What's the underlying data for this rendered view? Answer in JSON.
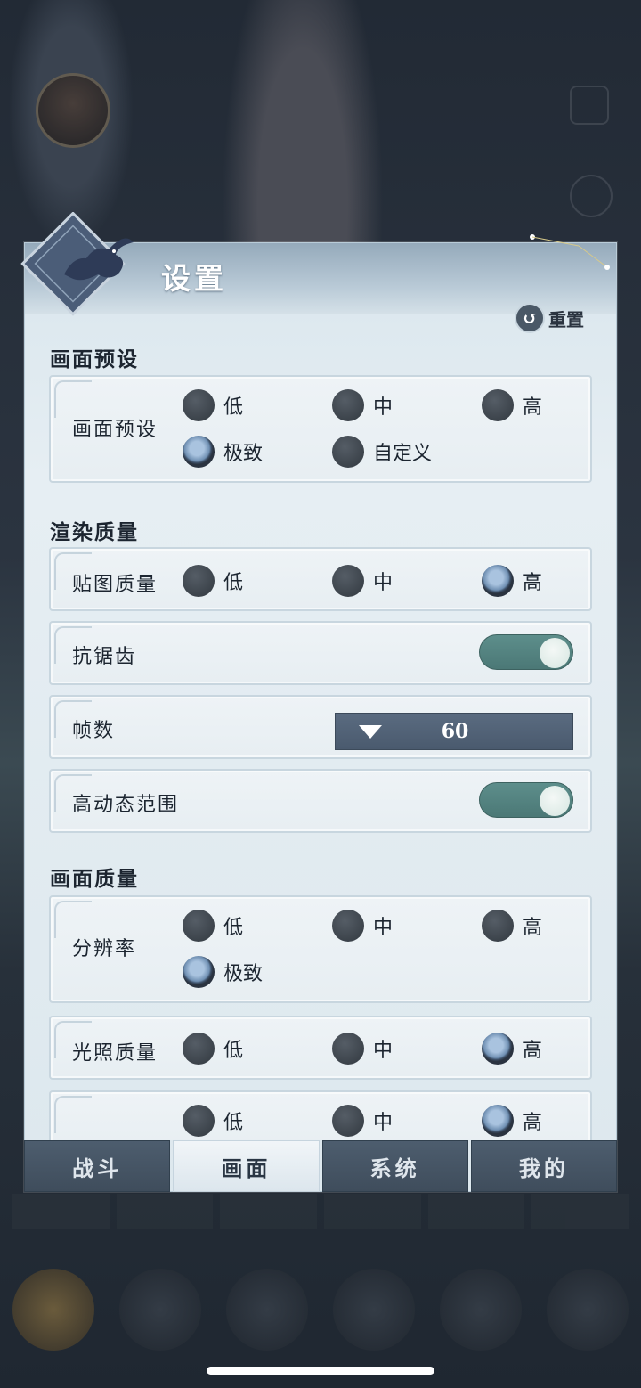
{
  "dialog": {
    "title": "设置",
    "reset_label": "重置"
  },
  "sections": {
    "preset_title": "画面预设",
    "render_title": "渲染质量",
    "quality_title": "画面质量"
  },
  "preset": {
    "label": "画面预设",
    "options": [
      "低",
      "中",
      "高",
      "极致",
      "自定义"
    ],
    "selected": "极致"
  },
  "texture": {
    "label": "贴图质量",
    "options": [
      "低",
      "中",
      "高"
    ],
    "selected": "高"
  },
  "antialias": {
    "label": "抗锯齿",
    "enabled": true
  },
  "fps": {
    "label": "帧数",
    "value": "60"
  },
  "hdr": {
    "label": "高动态范围",
    "enabled": true
  },
  "resolution": {
    "label": "分辨率",
    "options": [
      "低",
      "中",
      "高",
      "极致"
    ],
    "selected": "极致"
  },
  "lighting": {
    "label": "光照质量",
    "options": [
      "低",
      "中",
      "高"
    ],
    "selected": "高"
  },
  "partial_row": {
    "options": [
      "低",
      "中",
      "高"
    ],
    "selected": "高"
  },
  "tabs": [
    {
      "label": "战斗",
      "active": false
    },
    {
      "label": "画面",
      "active": true
    },
    {
      "label": "系统",
      "active": false
    },
    {
      "label": "我的",
      "active": false
    }
  ],
  "colors": {
    "toggle_on": "#5d8e8b",
    "dropdown": "#5a6b80",
    "tab_inactive": "#4d5d6e"
  }
}
